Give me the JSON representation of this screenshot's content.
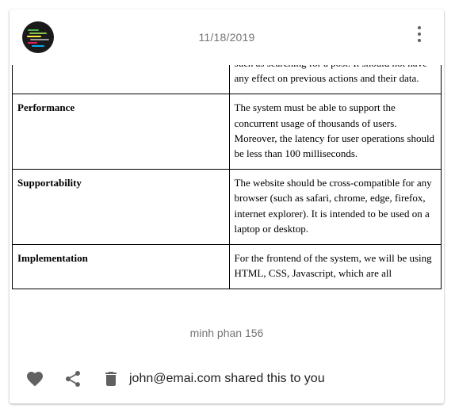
{
  "post": {
    "date": "11/18/2019",
    "caption": "minh phan 156",
    "shared_text": "john@emai.com shared this to you"
  },
  "icons": {
    "avatar": "avatar",
    "more": "more-vert-icon",
    "like": "heart-icon",
    "share": "share-icon",
    "delete": "trash-icon"
  },
  "document": {
    "rows": [
      {
        "key": "",
        "value": "such as searching for a post. It should not have any effect on previous actions and their data."
      },
      {
        "key": "Performance",
        "value": "The system must be able to support the concurrent usage of thousands of users. Moreover, the latency for user operations should be less than 100 milliseconds."
      },
      {
        "key": "Supportability",
        "value": "The website should be cross-compatible for any browser (such as safari, chrome, edge, firefox, internet explorer). It is intended to be used on a laptop or desktop."
      },
      {
        "key": "Implementation",
        "value": "For the frontend of the system, we will be using HTML, CSS, Javascript, which are all"
      }
    ]
  },
  "colors": {
    "icon": "#616161",
    "muted_text": "#757575"
  }
}
